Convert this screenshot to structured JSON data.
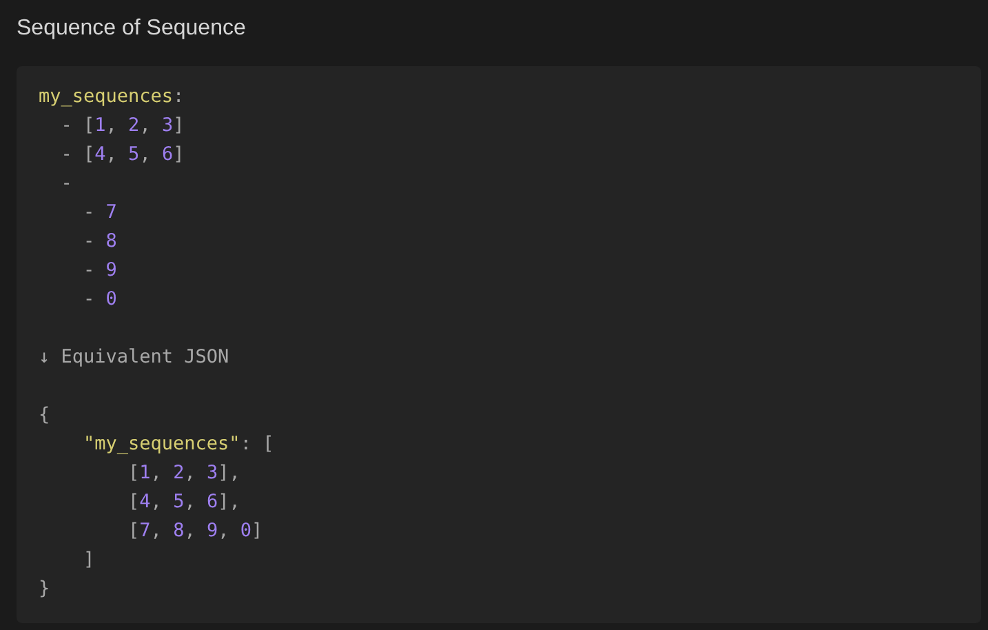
{
  "title": "Sequence of Sequence",
  "code_block": {
    "yaml_lines": [
      [
        {
          "text": "my_sequences",
          "kind": "key"
        },
        {
          "text": ":",
          "kind": "punct"
        }
      ],
      [
        {
          "text": "  - [",
          "kind": "punct"
        },
        {
          "text": "1",
          "kind": "number"
        },
        {
          "text": ", ",
          "kind": "punct"
        },
        {
          "text": "2",
          "kind": "number"
        },
        {
          "text": ", ",
          "kind": "punct"
        },
        {
          "text": "3",
          "kind": "number"
        },
        {
          "text": "]",
          "kind": "punct"
        }
      ],
      [
        {
          "text": "  - [",
          "kind": "punct"
        },
        {
          "text": "4",
          "kind": "number"
        },
        {
          "text": ", ",
          "kind": "punct"
        },
        {
          "text": "5",
          "kind": "number"
        },
        {
          "text": ", ",
          "kind": "punct"
        },
        {
          "text": "6",
          "kind": "number"
        },
        {
          "text": "]",
          "kind": "punct"
        }
      ],
      [
        {
          "text": "  -",
          "kind": "punct"
        }
      ],
      [
        {
          "text": "    - ",
          "kind": "punct"
        },
        {
          "text": "7",
          "kind": "number"
        }
      ],
      [
        {
          "text": "    - ",
          "kind": "punct"
        },
        {
          "text": "8",
          "kind": "number"
        }
      ],
      [
        {
          "text": "    - ",
          "kind": "punct"
        },
        {
          "text": "9",
          "kind": "number"
        }
      ],
      [
        {
          "text": "    - ",
          "kind": "punct"
        },
        {
          "text": "0",
          "kind": "number"
        }
      ]
    ],
    "note": "↓ Equivalent JSON",
    "json_lines": [
      [
        {
          "text": "{",
          "kind": "punct"
        }
      ],
      [
        {
          "text": "    \"my_sequences\"",
          "kind": "key"
        },
        {
          "text": ": [",
          "kind": "punct"
        }
      ],
      [
        {
          "text": "        [",
          "kind": "punct"
        },
        {
          "text": "1",
          "kind": "number"
        },
        {
          "text": ", ",
          "kind": "punct"
        },
        {
          "text": "2",
          "kind": "number"
        },
        {
          "text": ", ",
          "kind": "punct"
        },
        {
          "text": "3",
          "kind": "number"
        },
        {
          "text": "],",
          "kind": "punct"
        }
      ],
      [
        {
          "text": "        [",
          "kind": "punct"
        },
        {
          "text": "4",
          "kind": "number"
        },
        {
          "text": ", ",
          "kind": "punct"
        },
        {
          "text": "5",
          "kind": "number"
        },
        {
          "text": ", ",
          "kind": "punct"
        },
        {
          "text": "6",
          "kind": "number"
        },
        {
          "text": "],",
          "kind": "punct"
        }
      ],
      [
        {
          "text": "        [",
          "kind": "punct"
        },
        {
          "text": "7",
          "kind": "number"
        },
        {
          "text": ", ",
          "kind": "punct"
        },
        {
          "text": "8",
          "kind": "number"
        },
        {
          "text": ", ",
          "kind": "punct"
        },
        {
          "text": "9",
          "kind": "number"
        },
        {
          "text": ", ",
          "kind": "punct"
        },
        {
          "text": "0",
          "kind": "number"
        },
        {
          "text": "]",
          "kind": "punct"
        }
      ],
      [
        {
          "text": "    ]",
          "kind": "punct"
        }
      ],
      [
        {
          "text": "}",
          "kind": "punct"
        }
      ]
    ]
  }
}
